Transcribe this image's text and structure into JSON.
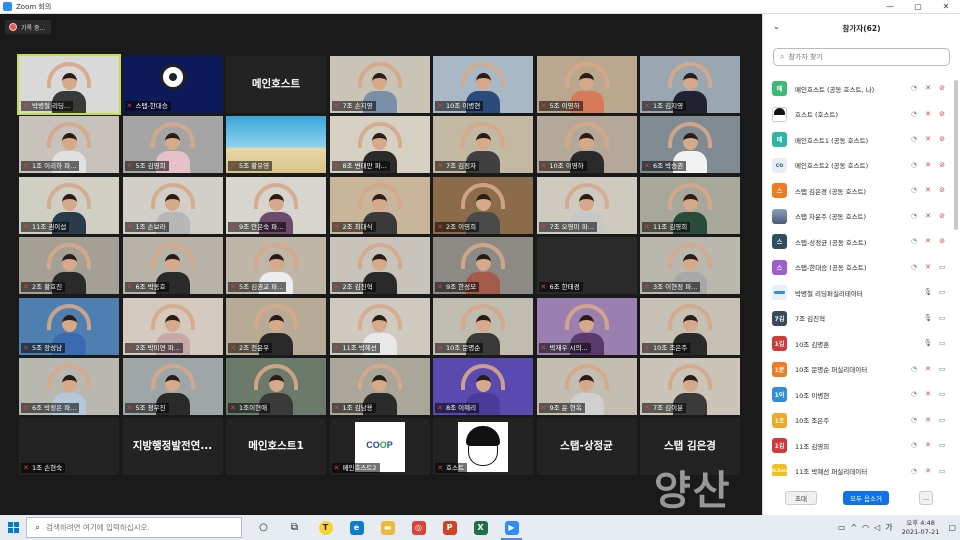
{
  "window": {
    "title": "Zoom 회의",
    "controls": [
      "—",
      "▢",
      "✕"
    ]
  },
  "recording": {
    "label": "기록 중..."
  },
  "grid": {
    "tiles": [
      {
        "name": "박병철 리딩...",
        "kind": "person",
        "shirt": "#3a3a3a",
        "bg": "#d9d9d9",
        "active": true
      },
      {
        "name": "스탭-한대승",
        "kind": "obs",
        "bg": "#0d1a5a"
      },
      {
        "name": "",
        "kind": "text",
        "text": "메인호스트"
      },
      {
        "name": "7조 손지영",
        "kind": "person",
        "shirt": "#7a8fa8",
        "bg": "#c9c4b5"
      },
      {
        "name": "10조 이병현",
        "kind": "person",
        "shirt": "#2b4b7a",
        "bg": "#a8b8c6"
      },
      {
        "name": "5조 이영하",
        "kind": "person",
        "shirt": "#d87a5a",
        "bg": "#bba78d"
      },
      {
        "name": "1조 김지영",
        "kind": "person",
        "shirt": "#223",
        "bg": "#9aa6b0"
      },
      {
        "name": "1조 이리하 파...",
        "kind": "person",
        "shirt": "#e0e0e0",
        "bg": "#c7c2bb"
      },
      {
        "name": "5조 김영희",
        "kind": "person",
        "shirt": "#e6c2c8",
        "bg": "#a5a5a5"
      },
      {
        "name": "5조 황유영",
        "kind": "beach",
        "bg": "#3aa7d8"
      },
      {
        "name": "8조 변태만 파...",
        "kind": "person",
        "shirt": "#2a2a2a",
        "bg": "#d5d0c2"
      },
      {
        "name": "7조 김정자",
        "kind": "person",
        "shirt": "#404040",
        "bg": "#c3b8a2"
      },
      {
        "name": "10조 이영하",
        "kind": "person",
        "shirt": "#2a2a2a",
        "bg": "#b5a89a"
      },
      {
        "name": "6조 박송권",
        "kind": "person",
        "shirt": "#f2f2f2",
        "bg": "#7f8a92"
      },
      {
        "name": "11조 권이섭",
        "kind": "person",
        "shirt": "#2a3a4a",
        "bg": "#cfcfc4"
      },
      {
        "name": "1조 손보라",
        "kind": "person",
        "shirt": "#b7b7b7",
        "bg": "#d2cfc8"
      },
      {
        "name": "9조 안은숙 파...",
        "kind": "person",
        "shirt": "#6c4b6b",
        "bg": "#d8d4ce"
      },
      {
        "name": "2조 최대식",
        "kind": "person",
        "shirt": "#3a3a3a",
        "bg": "#c8b59a"
      },
      {
        "name": "2조 이영희",
        "kind": "person",
        "shirt": "#4a4a4a",
        "bg": "#8a6b4a"
      },
      {
        "name": "7조 오영미 파...",
        "kind": "person",
        "shirt": "#c7c7c7",
        "bg": "#cfcac0"
      },
      {
        "name": "11조 김영희",
        "kind": "person",
        "shirt": "#2a4a3a",
        "bg": "#a8a89a"
      },
      {
        "name": "2조 황호진",
        "kind": "person",
        "shirt": "#2a2a2a",
        "bg": "#a5a095"
      },
      {
        "name": "6조 박동호",
        "kind": "person",
        "shirt": "#2a2a2a",
        "bg": "#b8b3a8"
      },
      {
        "name": "5조 김권교 파...",
        "kind": "person",
        "shirt": "#ededed",
        "bg": "#bfb6a7"
      },
      {
        "name": "2조 김진혁",
        "kind": "person",
        "shirt": "#2a2a2a",
        "bg": "#c8c4bb"
      },
      {
        "name": "9조 한성모",
        "kind": "person",
        "shirt": "#a35a4a",
        "bg": "#8d8a85"
      },
      {
        "name": "6조 한태경",
        "kind": "dark",
        "bg": "#2a2a2a"
      },
      {
        "name": "3조 이현정 파...",
        "kind": "person",
        "shirt": "#a8a8a8",
        "bg": "#bab8ae"
      },
      {
        "name": "5조 장성남",
        "kind": "person",
        "shirt": "#3a6ab0",
        "bg": "#4f7fb0"
      },
      {
        "name": "2조 박미연 파...",
        "kind": "person",
        "shirt": "#c7a8a8",
        "bg": "#d4c9bf"
      },
      {
        "name": "2조 천윤우",
        "kind": "person",
        "shirt": "#2a2a2a",
        "bg": "#b7aa96"
      },
      {
        "name": "11조 박혜선",
        "kind": "person",
        "shirt": "#e8e8e8",
        "bg": "#cfc9bf"
      },
      {
        "name": "10조 문명순",
        "kind": "person",
        "shirt": "#3a3a3a",
        "bg": "#c0bcb0"
      },
      {
        "name": "박재우 시의...",
        "kind": "person",
        "shirt": "#5a3a6a",
        "bg": "#9a7fb0"
      },
      {
        "name": "10조 조은주",
        "kind": "person",
        "shirt": "#2a2a2a",
        "bg": "#c7c1b5"
      },
      {
        "name": "6조 박정은 파...",
        "kind": "person",
        "shirt": "#b5c7d8",
        "bg": "#b8b8b0"
      },
      {
        "name": "5조 정우진",
        "kind": "person",
        "shirt": "#2a2a2a",
        "bg": "#9fa6a8"
      },
      {
        "name": "1조이현애",
        "kind": "person",
        "shirt": "#3a3a3a",
        "bg": "#6b7a6a"
      },
      {
        "name": "1조 김남용",
        "kind": "person",
        "shirt": "#2a2a2a",
        "bg": "#aaa69a"
      },
      {
        "name": "8조 이혜리",
        "kind": "person",
        "shirt": "#4a3a9a",
        "bg": "#5a4ab0"
      },
      {
        "name": "9조 윤 현옥",
        "kind": "person",
        "shirt": "#d0d0d0",
        "bg": "#c4bdb1"
      },
      {
        "name": "7조 김이분",
        "kind": "person",
        "shirt": "#3a3a3a",
        "bg": "#cac4b9"
      },
      {
        "name": "1조 손현숙",
        "kind": "text",
        "text": ""
      },
      {
        "name": "",
        "kind": "text",
        "text": "지방행정발전연..."
      },
      {
        "name": "",
        "kind": "text",
        "text": "메인호스트1"
      },
      {
        "name": "메인호스트2",
        "kind": "logo",
        "logo": "coop"
      },
      {
        "name": "호스트",
        "kind": "logo",
        "logo": "face"
      },
      {
        "name": "",
        "kind": "text",
        "text": "스탭-상정균"
      },
      {
        "name": "",
        "kind": "text",
        "text": "스탭 김은경"
      }
    ]
  },
  "panel": {
    "title": "참가자(62)",
    "search_placeholder": "참가자 찾기",
    "participants": [
      {
        "name": "메인호스트 (공동 호스트, 나)",
        "avatar": "메",
        "color": "#3cb878",
        "mic": "off",
        "cam": "off"
      },
      {
        "name": "호스트 (호스트)",
        "avatar": "",
        "color": "#ffffff",
        "image": "face",
        "mic": "off",
        "cam": "off"
      },
      {
        "name": "메인호스트1 (공동 호스트)",
        "avatar": "메",
        "color": "#2fb5a5",
        "mic": "off",
        "cam": "off"
      },
      {
        "name": "메인호스트2 (공동 호스트)",
        "avatar": "co",
        "color": "#e8eef5",
        "mic": "off",
        "cam": "off"
      },
      {
        "name": "스탭 김은경 (공동 호스트)",
        "avatar": "스",
        "color": "#f07c22",
        "mic": "off",
        "cam": "off"
      },
      {
        "name": "스탭 차윤주 (공동 호스트)",
        "avatar": "",
        "color": "#5a6a8a",
        "image": "photo",
        "mic": "off",
        "cam": "off"
      },
      {
        "name": "스탭-상정균 (공동 호스트)",
        "avatar": "스",
        "color": "#2f4f5f",
        "mic": "off",
        "cam": "off"
      },
      {
        "name": "스탭-한대승 (공동 호스트)",
        "avatar": "스",
        "color": "#9b5fd0",
        "mic": "off",
        "cam": "on"
      },
      {
        "name": "박병철 리딩퍼실리테이터",
        "avatar": "",
        "color": "#e8eef5",
        "image": "logo",
        "mic": "on",
        "cam": "on"
      },
      {
        "name": "7조 김진혁",
        "avatar": "7김",
        "color": "#3a4a5a",
        "mic": "on",
        "cam": "on"
      },
      {
        "name": "10조 김명훈",
        "avatar": "1김",
        "color": "#d03a3a",
        "mic": "on",
        "cam": "on"
      },
      {
        "name": "10조 문명순 퍼실리데이터",
        "avatar": "1문",
        "color": "#f07c22",
        "mic": "off",
        "cam": "on"
      },
      {
        "name": "10조 이병현",
        "avatar": "1이",
        "color": "#2f8fd8",
        "mic": "off",
        "cam": "on"
      },
      {
        "name": "10조 조은주",
        "avatar": "1조",
        "color": "#f0a82a",
        "mic": "off",
        "cam": "on"
      },
      {
        "name": "11조 김영희",
        "avatar": "1김",
        "color": "#d03a3a",
        "mic": "off",
        "cam": "on"
      },
      {
        "name": "11조 박혜선 퍼실리데이터",
        "avatar": "H.Sun",
        "color": "#f0c020",
        "mic": "off",
        "cam": "on"
      }
    ],
    "footer": {
      "invite": "초대",
      "unmute": "모두 음소거",
      "more": "..."
    }
  },
  "watermark": "양산",
  "taskbar": {
    "search_placeholder": "검색하려면 여기에 입력하십시오.",
    "apps": [
      {
        "icon": "cortana-icon",
        "glyph": "○"
      },
      {
        "icon": "taskview-icon",
        "glyph": "⧉"
      },
      {
        "icon": "kakaotalk-icon",
        "glyph": "T",
        "color": "#f7d52a"
      },
      {
        "icon": "edge-icon",
        "glyph": "e",
        "color": "#0f7bcf"
      },
      {
        "icon": "file-explorer-icon",
        "glyph": "▬",
        "color": "#f0b93a"
      },
      {
        "icon": "chrome-icon",
        "glyph": "◎",
        "color": "#db4437"
      },
      {
        "icon": "powerpoint-icon",
        "glyph": "P",
        "color": "#d04423"
      },
      {
        "icon": "excel-icon",
        "glyph": "X",
        "color": "#1e7145"
      },
      {
        "icon": "zoom-icon",
        "glyph": "▶",
        "color": "#2d8cff",
        "active": true
      }
    ],
    "ime": "가",
    "time": "오후 4:48",
    "date": "2021-07-21"
  }
}
